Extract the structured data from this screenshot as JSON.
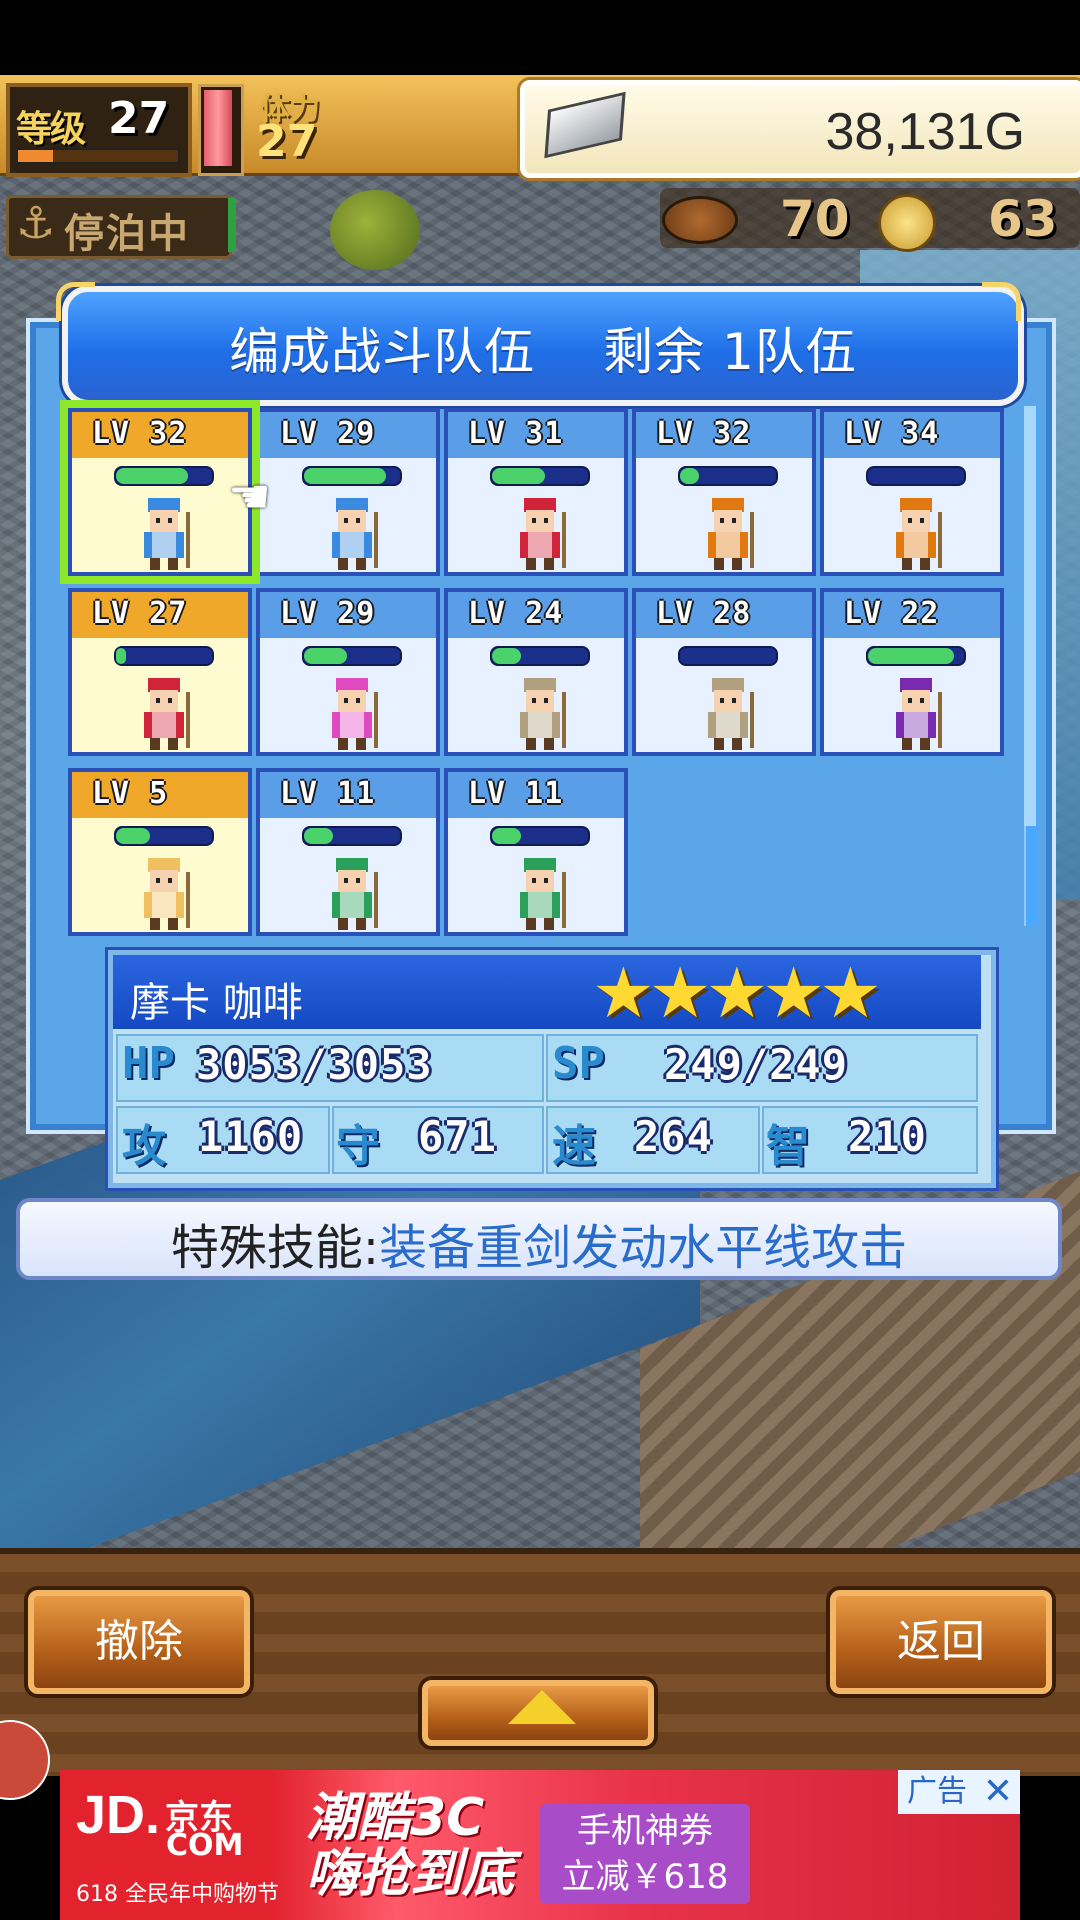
{
  "hud": {
    "level_label": "等级",
    "level": "27",
    "level_progress": 0.22,
    "stamina_label": "体力",
    "stamina": "27",
    "gold": "38,131G",
    "status": "停泊中",
    "food": "70",
    "coins": "63"
  },
  "panel": {
    "title": "编成战斗队伍　 剩余 1队伍"
  },
  "roster": [
    {
      "lv": "LV  32",
      "team": true,
      "selected": true,
      "hp": 0.75,
      "color": "#3a8adf"
    },
    {
      "lv": "LV  29",
      "team": false,
      "selected": false,
      "hp": 0.85,
      "color": "#3a8adf"
    },
    {
      "lv": "LV  31",
      "team": false,
      "selected": false,
      "hp": 0.55,
      "color": "#d0243a"
    },
    {
      "lv": "LV  32",
      "team": false,
      "selected": false,
      "hp": 0.2,
      "color": "#e07a10"
    },
    {
      "lv": "LV  34",
      "team": false,
      "selected": false,
      "hp": 0.0,
      "color": "#e07a10"
    },
    {
      "lv": "LV  27",
      "team": true,
      "selected": false,
      "hp": 0.1,
      "color": "#d0243a"
    },
    {
      "lv": "LV  29",
      "team": false,
      "selected": false,
      "hp": 0.45,
      "color": "#e04ac0"
    },
    {
      "lv": "LV  24",
      "team": false,
      "selected": false,
      "hp": 0.3,
      "color": "#b0a080"
    },
    {
      "lv": "LV  28",
      "team": false,
      "selected": false,
      "hp": 0.0,
      "color": "#b0a080"
    },
    {
      "lv": "LV  22",
      "team": false,
      "selected": false,
      "hp": 0.9,
      "color": "#7a2ab0"
    },
    {
      "lv": "LV   5",
      "team": true,
      "selected": false,
      "hp": 0.35,
      "color": "#f0c060"
    },
    {
      "lv": "LV  11",
      "team": false,
      "selected": false,
      "hp": 0.3,
      "color": "#2aa05a"
    },
    {
      "lv": "LV  11",
      "team": false,
      "selected": false,
      "hp": 0.3,
      "color": "#2aa05a"
    }
  ],
  "character": {
    "name": "摩卡 咖啡",
    "stars": "★★★★★",
    "rating": 5,
    "hp_label": "HP",
    "hp": "3053/3053",
    "sp_label": "SP",
    "sp": "249/249",
    "atk_label": "攻",
    "atk": "1160",
    "def_label": "守",
    "def": "671",
    "spd_label": "速",
    "spd": "264",
    "int_label": "智",
    "int": "210"
  },
  "skill": {
    "label": "特殊技能:",
    "value": "装备重剑发动水平线攻击"
  },
  "buttons": {
    "remove": "撤除",
    "back": "返回"
  },
  "ad": {
    "brand": "JD.",
    "brand_cn": "京东",
    "brand_com": "COM",
    "sub": "618 全民年中购物节",
    "slogan_1": "潮酷3C",
    "slogan_2": "嗨抢到底",
    "coupon_1": "手机神券",
    "coupon_2": "立减￥618",
    "label": "广告",
    "close": "✕"
  }
}
